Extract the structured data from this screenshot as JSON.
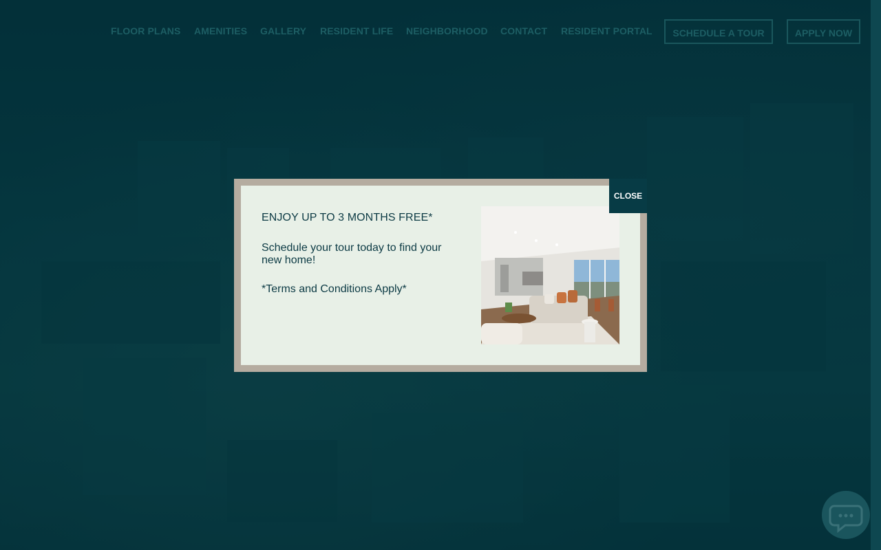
{
  "nav": {
    "links": [
      "FLOOR PLANS",
      "AMENITIES",
      "GALLERY",
      "RESIDENT LIFE",
      "NEIGHBORHOOD",
      "CONTACT",
      "RESIDENT PORTAL"
    ],
    "schedule_tour": "SCHEDULE A TOUR",
    "apply_now": "APPLY NOW"
  },
  "modal": {
    "heading": "ENJOY UP TO 3 MONTHS FREE*",
    "body": "Schedule your tour today to find your new home!",
    "terms": "*Terms and Conditions Apply*",
    "close_label": "CLOSE"
  },
  "icons": {
    "chat": "chat-bubble-icon"
  },
  "colors": {
    "brand_teal": "#073b45",
    "modal_frame": "#b5aca0",
    "modal_bg": "#e8f0e7"
  }
}
